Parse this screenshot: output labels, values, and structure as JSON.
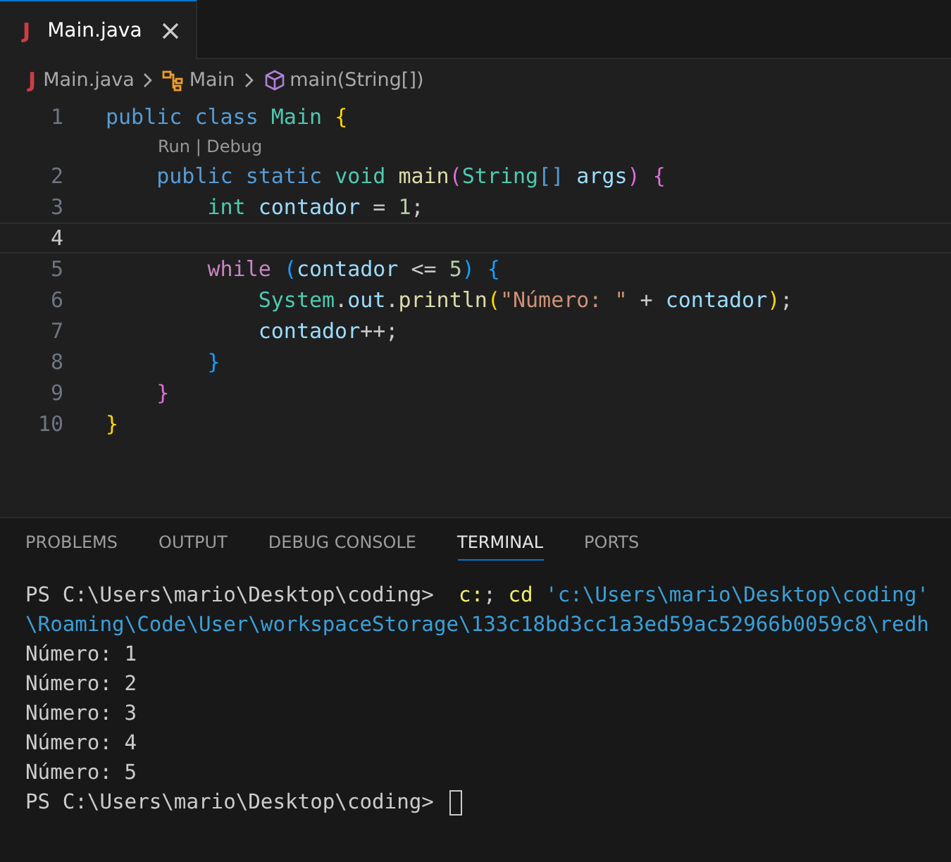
{
  "tabs": [
    {
      "icon": "J",
      "label": "Main.java",
      "selected": true
    }
  ],
  "breadcrumb": [
    {
      "kind": "file",
      "icon": "J",
      "label": "Main.java"
    },
    {
      "kind": "class",
      "label": "Main"
    },
    {
      "kind": "method",
      "label": "main(String[])"
    }
  ],
  "code": [
    {
      "number": "1",
      "current": false,
      "tokens": [
        {
          "t": "public class ",
          "kind": "keyword"
        },
        {
          "t": "Main ",
          "kind": "type"
        },
        {
          "t": "{",
          "kind": "brace1"
        }
      ]
    },
    {
      "kind": "codelens",
      "text": "Run | Debug"
    },
    {
      "number": "2",
      "current": false,
      "tokens": [
        {
          "t": "    public static ",
          "kind": "keyword"
        },
        {
          "t": "void ",
          "kind": "type"
        },
        {
          "t": "main",
          "kind": "func"
        },
        {
          "t": "(",
          "kind": "brace2"
        },
        {
          "t": "String",
          "kind": "type"
        },
        {
          "t": "[] ",
          "kind": "keyword"
        },
        {
          "t": "args",
          "kind": "var"
        },
        {
          "t": ") {",
          "kind": "brace2"
        }
      ]
    },
    {
      "number": "3",
      "current": false,
      "tokens": [
        {
          "t": "        int ",
          "kind": "type"
        },
        {
          "t": "contador",
          "kind": "var"
        },
        {
          "t": " = ",
          "kind": "plain"
        },
        {
          "t": "1",
          "kind": "number"
        },
        {
          "t": ";",
          "kind": "plain"
        }
      ]
    },
    {
      "number": "4",
      "current": true
    },
    {
      "number": "5",
      "current": false,
      "tokens": [
        {
          "t": "        while ",
          "kind": "control"
        },
        {
          "t": "(",
          "kind": "brace3"
        },
        {
          "t": "contador",
          "kind": "var"
        },
        {
          "t": " <= ",
          "kind": "plain"
        },
        {
          "t": "5",
          "kind": "number"
        },
        {
          "t": ") {",
          "kind": "brace3"
        }
      ]
    },
    {
      "number": "6",
      "current": false,
      "tokens": [
        {
          "t": "            System",
          "kind": "type"
        },
        {
          "t": ".",
          "kind": "plain"
        },
        {
          "t": "out",
          "kind": "var"
        },
        {
          "t": ".",
          "kind": "plain"
        },
        {
          "t": "println",
          "kind": "func"
        },
        {
          "t": "(",
          "kind": "brace1"
        },
        {
          "t": "\"Número: \"",
          "kind": "string"
        },
        {
          "t": " + ",
          "kind": "plain"
        },
        {
          "t": "contador",
          "kind": "var"
        },
        {
          "t": ")",
          "kind": "brace1"
        },
        {
          "t": ";",
          "kind": "plain"
        }
      ]
    },
    {
      "number": "7",
      "current": false,
      "tokens": [
        {
          "t": "            contador",
          "kind": "var"
        },
        {
          "t": "++;",
          "kind": "plain"
        }
      ]
    },
    {
      "number": "8",
      "current": false,
      "tokens": [
        {
          "t": "        }",
          "kind": "brace3"
        }
      ]
    },
    {
      "number": "9",
      "current": false,
      "tokens": [
        {
          "t": "    }",
          "kind": "brace2"
        }
      ]
    },
    {
      "number": "10",
      "current": false,
      "tokens": [
        {
          "t": "}",
          "kind": "brace1"
        }
      ]
    }
  ],
  "panel_tabs": [
    {
      "label": "PROBLEMS",
      "selected": false
    },
    {
      "label": "OUTPUT",
      "selected": false
    },
    {
      "label": "DEBUG CONSOLE",
      "selected": false
    },
    {
      "label": "TERMINAL",
      "selected": true
    },
    {
      "label": "PORTS",
      "selected": false
    }
  ],
  "terminal": [
    {
      "cursor": false,
      "tokens": [
        {
          "t": "PS C:\\Users\\mario\\Desktop\\coding>  ",
          "kind": "plain"
        },
        {
          "t": "c:",
          "kind": "command"
        },
        {
          "t": "; ",
          "kind": "plain"
        },
        {
          "t": "cd ",
          "kind": "command"
        },
        {
          "t": "'c:\\Users\\mario\\Desktop\\coding'",
          "kind": "path"
        }
      ]
    },
    {
      "cursor": false,
      "tokens": [
        {
          "t": "\\Roaming\\Code\\User\\workspaceStorage\\133c18bd3cc1a3ed59ac52966b0059c8\\redh",
          "kind": "path"
        }
      ]
    },
    {
      "cursor": false,
      "tokens": [
        {
          "t": "Número: 1",
          "kind": "plain"
        }
      ]
    },
    {
      "cursor": false,
      "tokens": [
        {
          "t": "Número: 2",
          "kind": "plain"
        }
      ]
    },
    {
      "cursor": false,
      "tokens": [
        {
          "t": "Número: 3",
          "kind": "plain"
        }
      ]
    },
    {
      "cursor": false,
      "tokens": [
        {
          "t": "Número: 4",
          "kind": "plain"
        }
      ]
    },
    {
      "cursor": false,
      "tokens": [
        {
          "t": "Número: 5",
          "kind": "plain"
        }
      ]
    },
    {
      "cursor": true,
      "tokens": [
        {
          "t": "PS C:\\Users\\mario\\Desktop\\coding> ",
          "kind": "plain"
        }
      ]
    }
  ]
}
